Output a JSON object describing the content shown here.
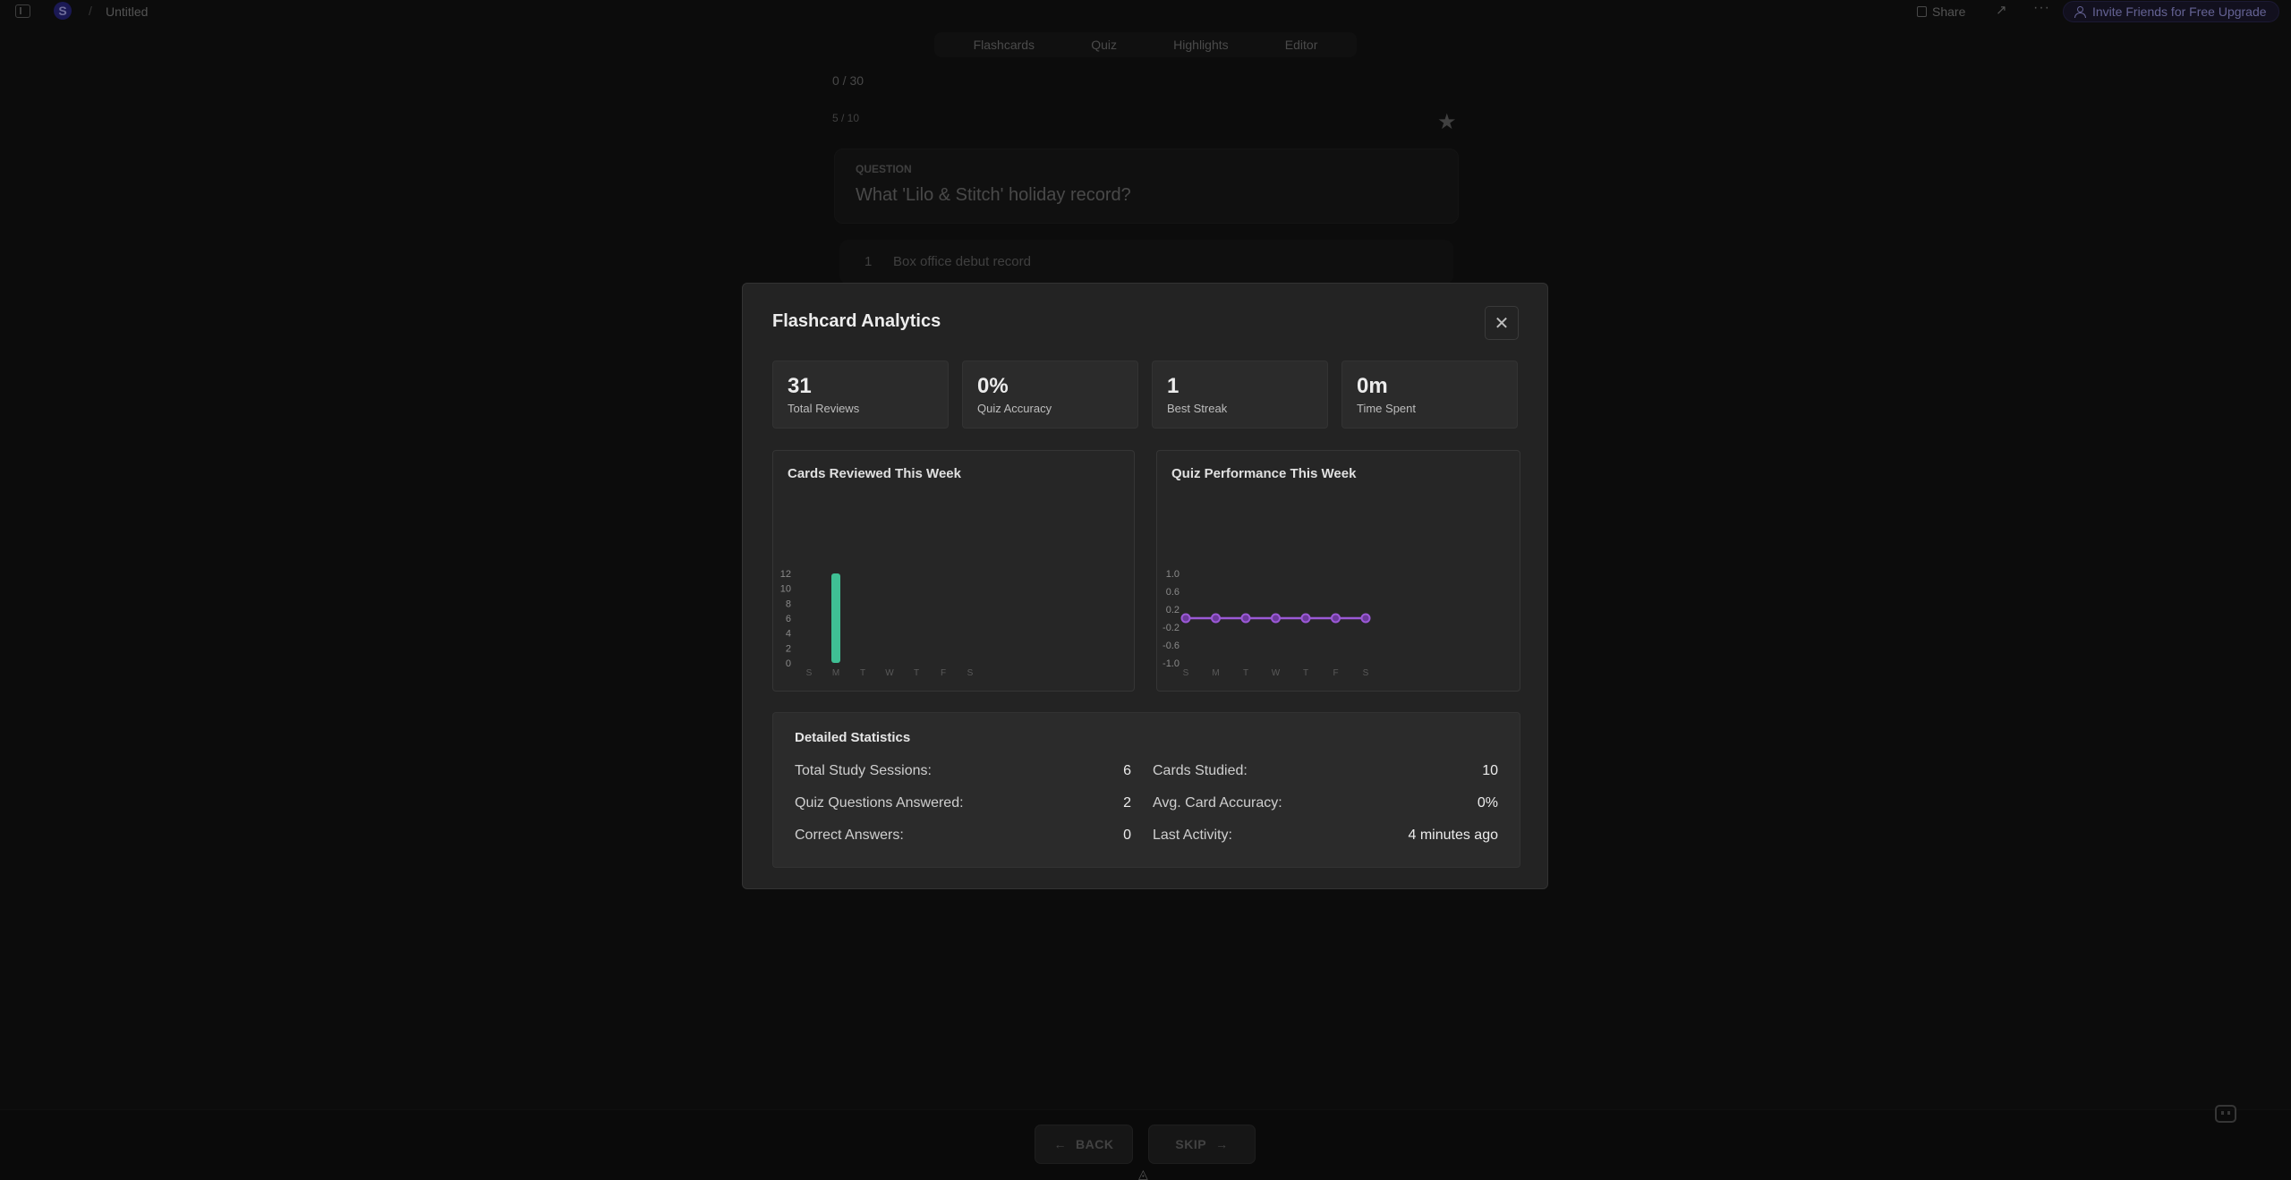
{
  "topbar": {
    "workspace_initial": "S",
    "separator": "/",
    "doc_title": "Untitled",
    "share_label": "Share",
    "trend_icon": "↗",
    "more_icon": "···",
    "invite_label": "Invite Friends for Free Upgrade"
  },
  "tabs": [
    "Flashcards",
    "Quiz",
    "Highlights",
    "Editor"
  ],
  "study": {
    "progress": "0 / 30",
    "card_index": "5 / 10",
    "question_label": "QUESTION",
    "question_text": "What 'Lilo & Stitch' holiday record?",
    "answer_number": "1",
    "answer_text": "Box office debut record",
    "back_label": "BACK",
    "skip_label": "SKIP",
    "back_arrow": "←",
    "skip_arrow": "→"
  },
  "modal": {
    "title": "Flashcard Analytics",
    "close_icon": "✕",
    "stats": [
      {
        "value": "31",
        "label": "Total Reviews"
      },
      {
        "value": "0%",
        "label": "Quiz Accuracy"
      },
      {
        "value": "1",
        "label": "Best Streak"
      },
      {
        "value": "0m",
        "label": "Time Spent"
      }
    ],
    "details": {
      "title": "Detailed Statistics",
      "rows": [
        {
          "label": "Total Study Sessions:",
          "value": "6"
        },
        {
          "label": "Cards Studied:",
          "value": "10"
        },
        {
          "label": "Quiz Questions Answered:",
          "value": "2"
        },
        {
          "label": "Avg. Card Accuracy:",
          "value": "0%"
        },
        {
          "label": "Correct Answers:",
          "value": "0"
        },
        {
          "label": "Last Activity:",
          "value": "4 minutes ago"
        }
      ]
    }
  },
  "chart_data": [
    {
      "type": "bar",
      "title": "Cards Reviewed This Week",
      "categories": [
        "S",
        "M",
        "T",
        "W",
        "T",
        "F",
        "S"
      ],
      "values": [
        0,
        12,
        0,
        0,
        0,
        0,
        0
      ],
      "ylim": [
        0,
        12
      ],
      "yticks": [
        "0",
        "2",
        "4",
        "6",
        "8",
        "10",
        "12"
      ],
      "color": "#3fbf94"
    },
    {
      "type": "line",
      "title": "Quiz Performance This Week",
      "categories": [
        "S",
        "M",
        "T",
        "W",
        "T",
        "F",
        "S"
      ],
      "values": [
        0,
        0,
        0,
        0,
        0,
        0,
        0
      ],
      "ylim": [
        -1.0,
        1.0
      ],
      "yticks": [
        "1.0",
        "0.6",
        "0.2",
        "-0.2",
        "-0.6",
        "-1.0"
      ],
      "color": "#9b59d6"
    }
  ]
}
